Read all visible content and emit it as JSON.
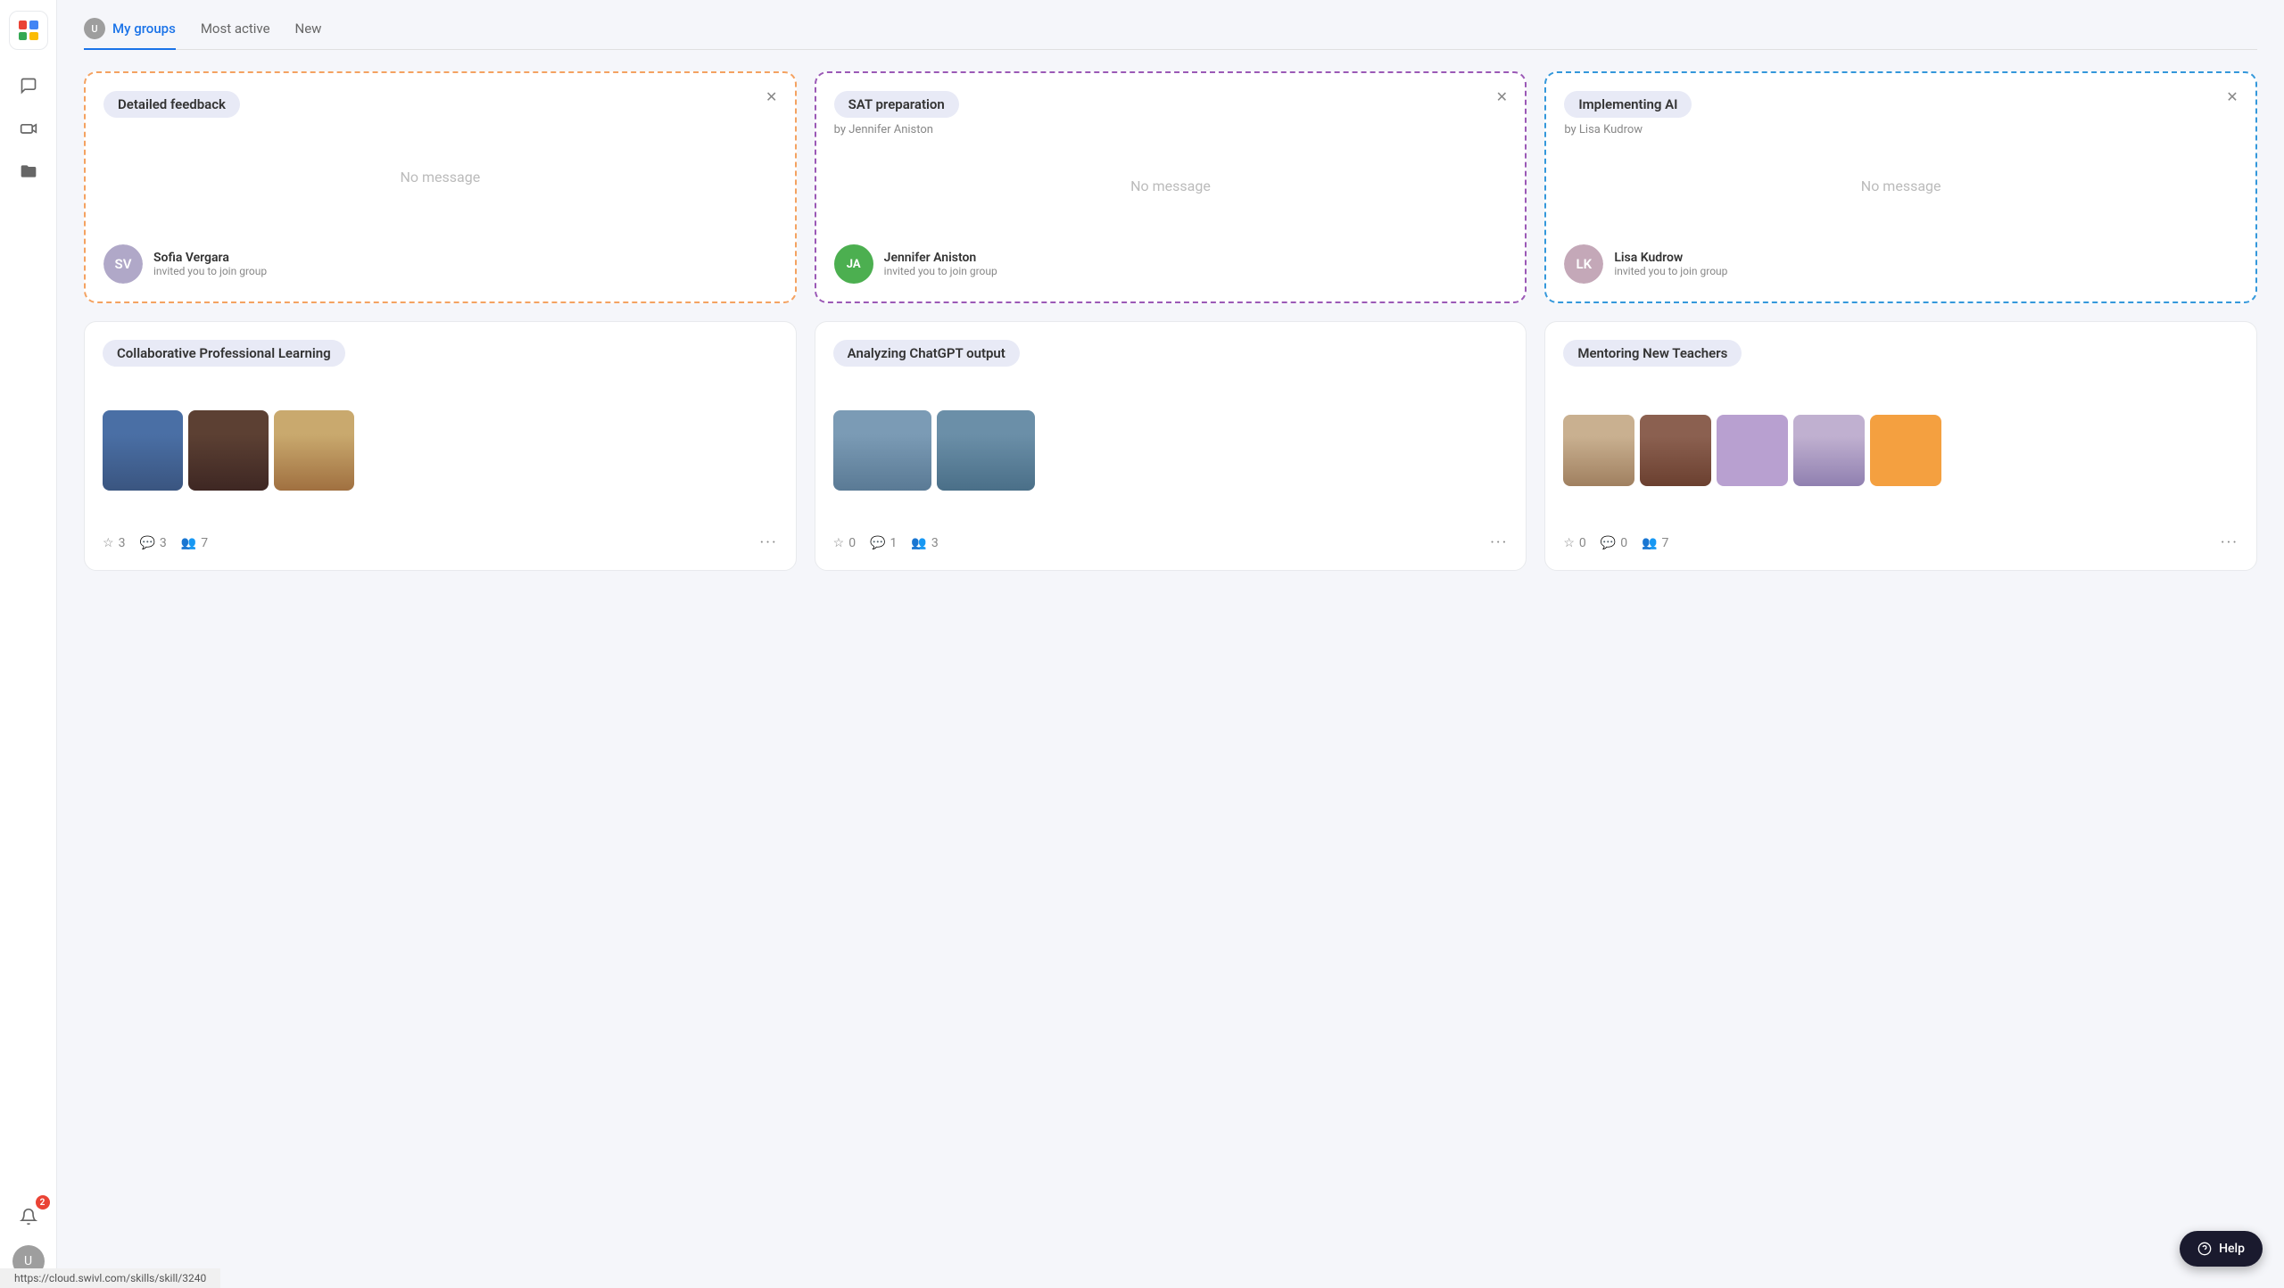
{
  "app": {
    "logo": "swivl-logo",
    "status_url": "https://cloud.swivl.com/skills/skill/3240"
  },
  "sidebar": {
    "icons": [
      {
        "name": "chat-icon",
        "symbol": "💬"
      },
      {
        "name": "video-icon",
        "symbol": "🎬"
      },
      {
        "name": "folder-icon",
        "symbol": "📁"
      }
    ]
  },
  "tabs": [
    {
      "id": "my-groups",
      "label": "My groups",
      "active": true,
      "has_avatar": true
    },
    {
      "id": "most-active",
      "label": "Most active",
      "active": false,
      "has_avatar": false
    },
    {
      "id": "new",
      "label": "New",
      "active": false,
      "has_avatar": false
    }
  ],
  "invite_cards": [
    {
      "id": "detailed-feedback",
      "title": "Detailed feedback",
      "border_color": "orange-dash",
      "no_message": "No message",
      "inviter_name": "Sofia Vergara",
      "inviter_sub": "invited you to join group",
      "inviter_initials": "SV",
      "inviter_type": "photo"
    },
    {
      "id": "sat-preparation",
      "title": "SAT preparation",
      "subtitle": "by Jennifer Aniston",
      "border_color": "purple-dash",
      "no_message": "No message",
      "inviter_name": "Jennifer Aniston",
      "inviter_sub": "invited you to join group",
      "inviter_initials": "JA",
      "inviter_type": "initials"
    },
    {
      "id": "implementing-ai",
      "title": "Implementing AI",
      "subtitle": "by Lisa Kudrow",
      "border_color": "blue-dash",
      "no_message": "No message",
      "inviter_name": "Lisa Kudrow",
      "inviter_sub": "invited you to join group",
      "inviter_initials": "LK",
      "inviter_type": "photo"
    }
  ],
  "group_cards": [
    {
      "id": "collaborative-professional-learning",
      "title": "Collaborative Professional Learning",
      "members": [
        "person-collab1",
        "person-collab2",
        "person-collab3"
      ],
      "stars": 3,
      "comments": 3,
      "members_count": 7
    },
    {
      "id": "analyzing-chatgpt-output",
      "title": "Analyzing ChatGPT output",
      "members": [
        "person-analyze1",
        "person-analyze2"
      ],
      "stars": 0,
      "comments": 1,
      "members_count": 3
    },
    {
      "id": "mentoring-new-teachers",
      "title": "Mentoring New Teachers",
      "members": [
        "person-mentor1",
        "person-mentor2",
        "person-mentor3",
        "orange"
      ],
      "stars": 0,
      "comments": 0,
      "members_count": 7
    }
  ],
  "help_button": {
    "label": "Help"
  },
  "notification": {
    "count": 2
  }
}
